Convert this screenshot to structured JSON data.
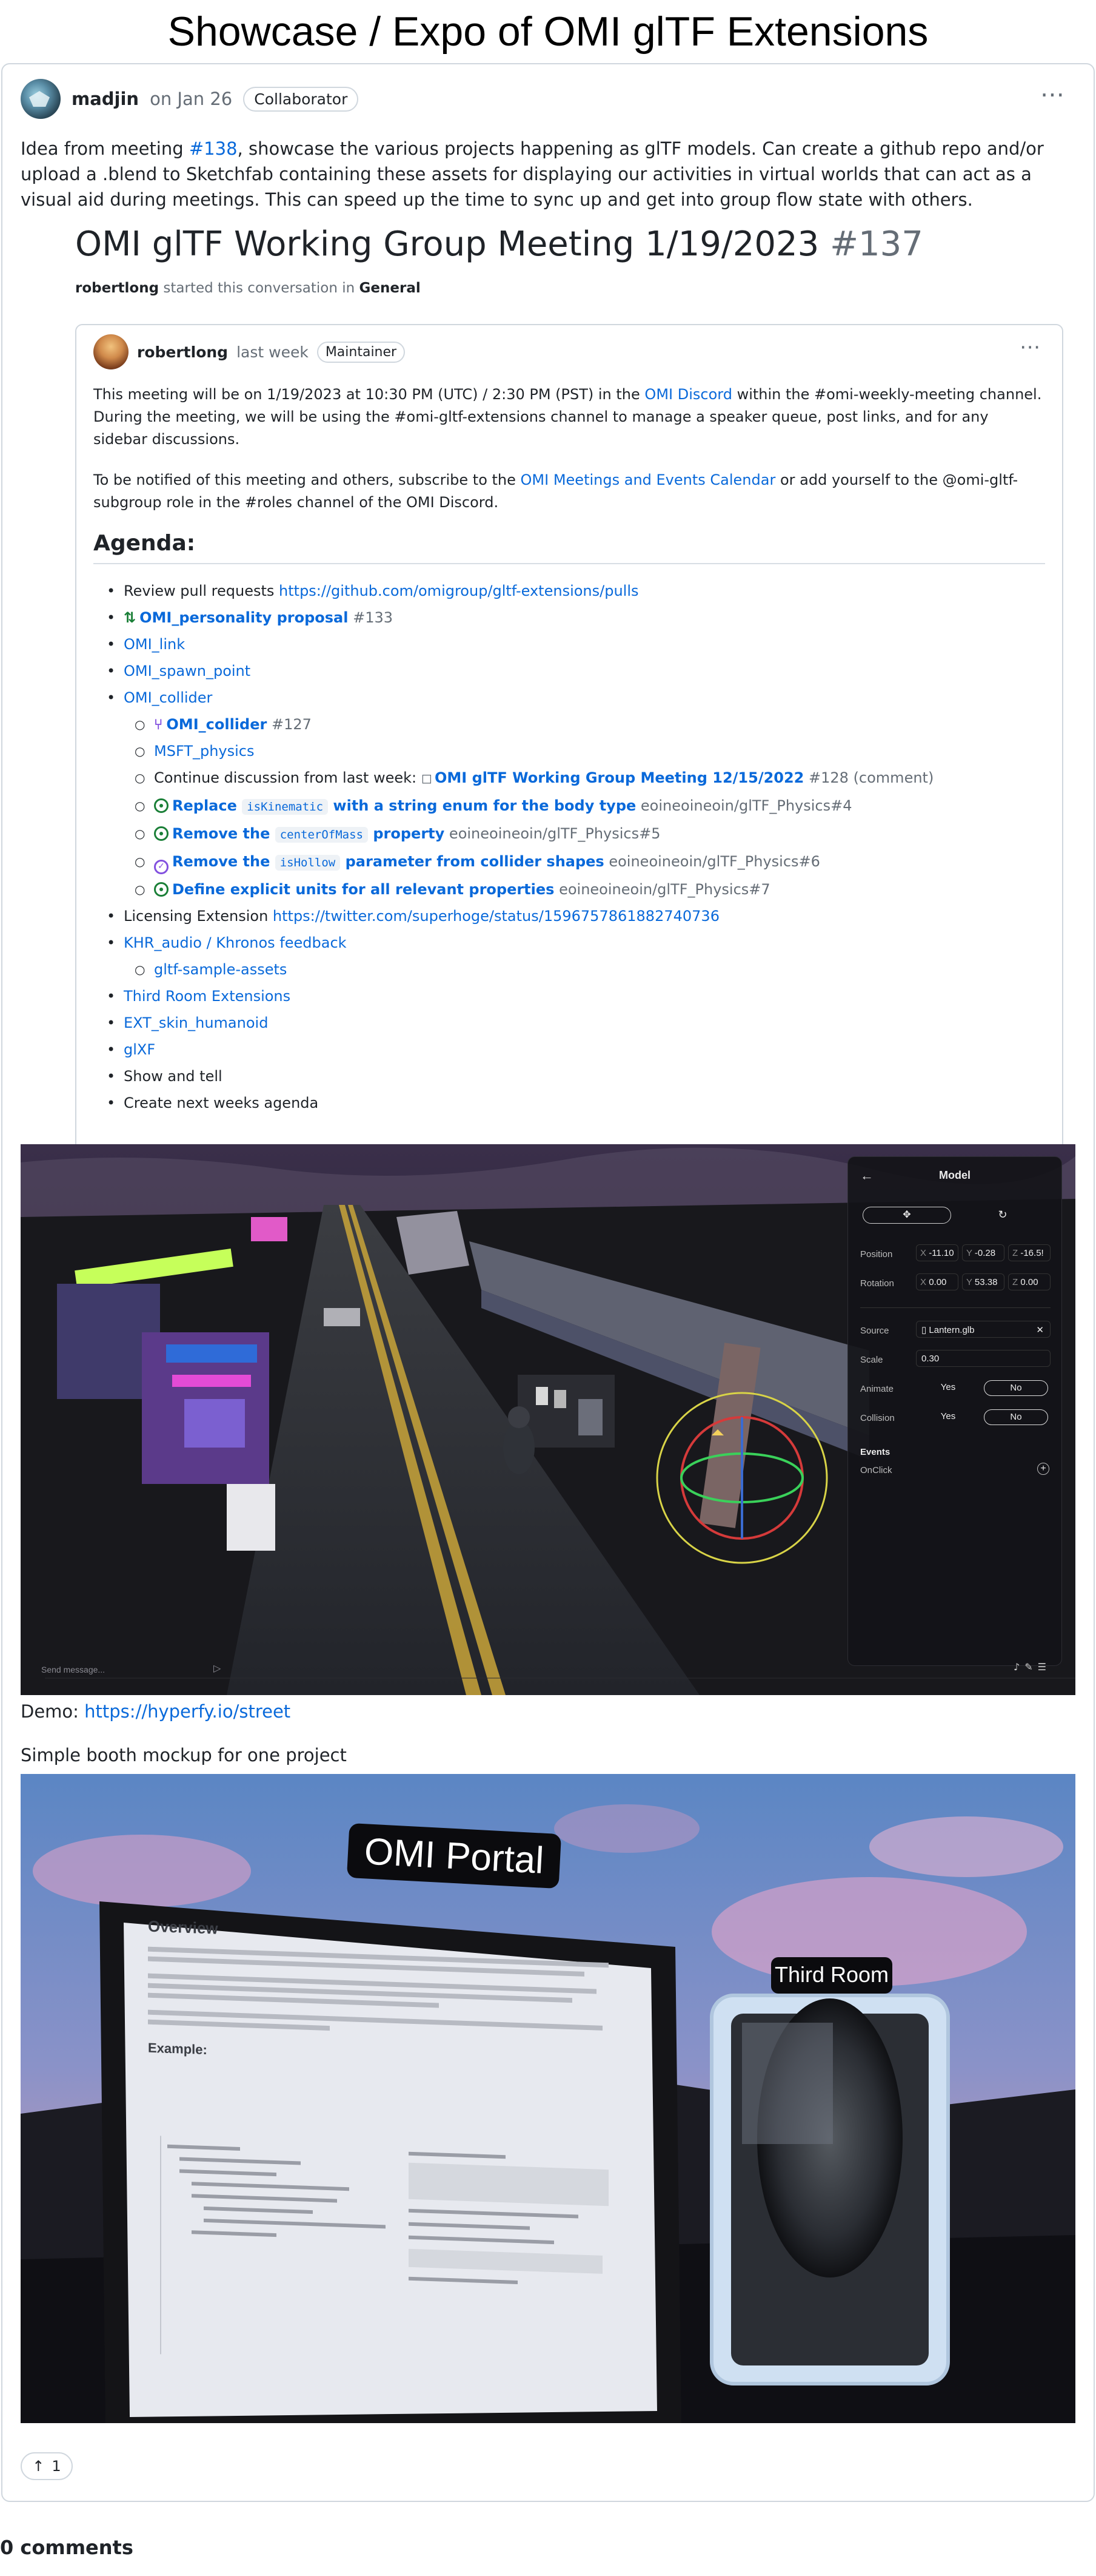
{
  "page": {
    "title": "Showcase / Expo of OMI glTF Extensions"
  },
  "post": {
    "author": "madjin",
    "date": "on Jan 26",
    "badge": "Collaborator",
    "intro_before": "Idea from meeting ",
    "intro_link": "#138",
    "intro_after": ", showcase the various projects happening as glTF models. Can create a github repo and/or upload a .blend to Sketchfab containing these assets for displaying our activities in virtual worlds that can act as a visual aid during meetings. This can speed up the time to sync up and get into group flow state with others."
  },
  "embed": {
    "title": "OMI glTF Working Group Meeting 1/19/2023",
    "number": "#137",
    "starter": "robertlong",
    "started_text": " started this conversation in ",
    "category": "General",
    "card": {
      "author": "robertlong",
      "date": "last week",
      "badge": "Maintainer",
      "p1_a": "This meeting will be on 1/19/2023 at 10:30 PM (UTC) / 2:30 PM (PST) in the ",
      "p1_link": "OMI Discord",
      "p1_b": " within the #omi-weekly-meeting channel. During the meeting, we will be using the #omi-gltf-extensions channel to manage a speaker queue, post links, and for any sidebar discussions.",
      "p2_a": "To be notified of this meeting and others, subscribe to the ",
      "p2_link": "OMI Meetings and Events Calendar",
      "p2_b": " or add yourself to the @omi-gltf-subgroup role in the #roles channel of the OMI Discord.",
      "agenda_heading": "Agenda:",
      "items": {
        "review_text": "Review pull requests ",
        "review_link": "https://github.com/omigroup/gltf-extensions/pulls",
        "personality": "OMI_personality proposal",
        "personality_num": "#133",
        "omi_link": "OMI_link",
        "spawn_point": "OMI_spawn_point",
        "collider": "OMI_collider",
        "collider_ref": "OMI_collider",
        "collider_num": "#127",
        "msft_physics": "MSFT_physics",
        "continue_text": "Continue discussion from last week: ",
        "continue_ref": "OMI glTF Working Group Meeting 12/15/2022",
        "continue_num": "#128 (comment)",
        "issue4_a": "Replace ",
        "issue4_code": "isKinematic",
        "issue4_b": " with a string enum for the body type",
        "issue4_repo": " eoineoineoin/glTF_Physics#4",
        "issue5_a": "Remove the ",
        "issue5_code": "centerOfMass",
        "issue5_b": " property",
        "issue5_repo": " eoineoineoin/glTF_Physics#5",
        "issue6_a": "Remove the ",
        "issue6_code": "isHollow",
        "issue6_b": " parameter from collider shapes",
        "issue6_repo": " eoineoineoin/glTF_Physics#6",
        "issue7_a": "Define explicit units for all relevant properties",
        "issue7_repo": " eoineoineoin/glTF_Physics#7",
        "licensing_text": "Licensing Extension ",
        "licensing_link": "https://twitter.com/superhoge/status/1596757861882740736",
        "khr_audio": "KHR_audio / Khronos feedback",
        "sample_assets": "gltf-sample-assets",
        "third_room": "Third Room Extensions",
        "ext_skin": "EXT_skin_humanoid",
        "glxf": "glXF",
        "show_tell": "Show and tell",
        "next_agenda": "Create next weeks agenda"
      }
    }
  },
  "screenshot1": {
    "panel_title": "Model",
    "position_label": "Position",
    "position_x": "-11.10",
    "position_y": "-0.28",
    "position_z": "-16.5!",
    "rotation_label": "Rotation",
    "rotation_x": "0.00",
    "rotation_y": "53.38",
    "rotation_z": "0.00",
    "source_label": "Source",
    "source_value": "Lantern.glb",
    "scale_label": "Scale",
    "scale_value": "0.30",
    "animate_label": "Animate",
    "collision_label": "Collision",
    "yes": "Yes",
    "no": "No",
    "events_label": "Events",
    "onclick_label": "OnClick",
    "send_placeholder": "Send message..."
  },
  "demo": {
    "label": "Demo: ",
    "link": "https://hyperfy.io/street"
  },
  "caption2": "Simple booth mockup for one project",
  "screenshot2": {
    "portal_sign": "OMI Portal",
    "room_sign": "Third Room",
    "doc_heading": "Overview",
    "example_label": "Example:"
  },
  "reactions": {
    "count": "1"
  },
  "comments": {
    "label": "0 comments"
  }
}
